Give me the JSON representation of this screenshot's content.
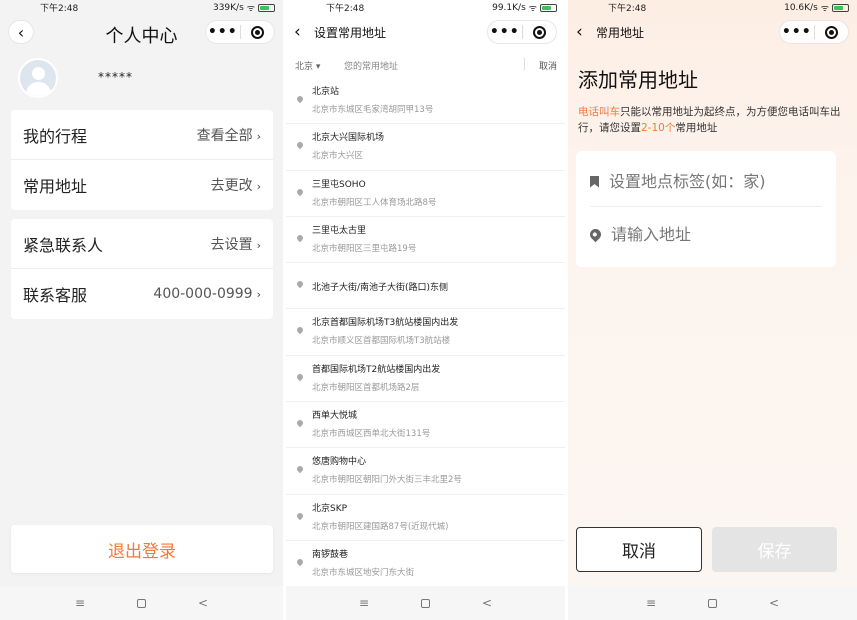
{
  "panels": {
    "profile": {
      "status": {
        "time": "下午2:48",
        "speed": "339K/s",
        "battery": "99"
      },
      "title": "个人中心",
      "username": "*****",
      "card1": [
        {
          "label": "我的行程",
          "value": "查看全部"
        },
        {
          "label": "常用地址",
          "value": "去更改"
        }
      ],
      "card2": [
        {
          "label": "紧急联系人",
          "value": "去设置"
        },
        {
          "label": "联系客服",
          "value": "400-000-0999"
        }
      ],
      "logout": "退出登录"
    },
    "set_address": {
      "status": {
        "time": "下午2:48",
        "speed": "99.1K/s",
        "battery": "99"
      },
      "title": "设置常用地址",
      "search": {
        "city": "北京",
        "placeholder": "您的常用地址",
        "cancel": "取消"
      },
      "items": [
        {
          "name": "北京站",
          "sub": "北京市东城区毛家湾胡同甲13号"
        },
        {
          "name": "北京大兴国际机场",
          "sub": "北京市大兴区"
        },
        {
          "name": "三里屯SOHO",
          "sub": "北京市朝阳区工人体育场北路8号"
        },
        {
          "name": "三里屯太古里",
          "sub": "北京市朝阳区三里屯路19号"
        },
        {
          "name": "北池子大街/南池子大街(路口)东侧",
          "sub": ""
        },
        {
          "name": "北京首都国际机场T3航站楼国内出发",
          "sub": "北京市顺义区首都国际机场T3航站楼"
        },
        {
          "name": "首都国际机场T2航站楼国内出发",
          "sub": "北京市朝阳区首都机场路2层"
        },
        {
          "name": "西单大悦城",
          "sub": "北京市西城区西单北大街131号"
        },
        {
          "name": "悠唐购物中心",
          "sub": "北京市朝阳区朝阳门外大街三丰北里2号"
        },
        {
          "name": "北京SKP",
          "sub": "北京市朝阳区建国路87号(近现代城)"
        },
        {
          "name": "南锣鼓巷",
          "sub": "北京市东城区地安门东大街"
        }
      ]
    },
    "add_address": {
      "status": {
        "time": "下午2:48",
        "speed": "10.6K/s",
        "battery": "99"
      },
      "nav_title": "常用地址",
      "heading": "添加常用地址",
      "desc_highlight1": "电话叫车",
      "desc_part1": "只能以常用地址为起终点，为方便您电话叫车出行，请您设置",
      "desc_highlight2": "2-10个",
      "desc_part2": "常用地址",
      "label_placeholder": "设置地点标签(如：家)",
      "address_placeholder": "请输入地址",
      "cancel": "取消",
      "save": "保存"
    }
  },
  "nav": {
    "menu": "≡",
    "home": "□",
    "back": "<"
  }
}
